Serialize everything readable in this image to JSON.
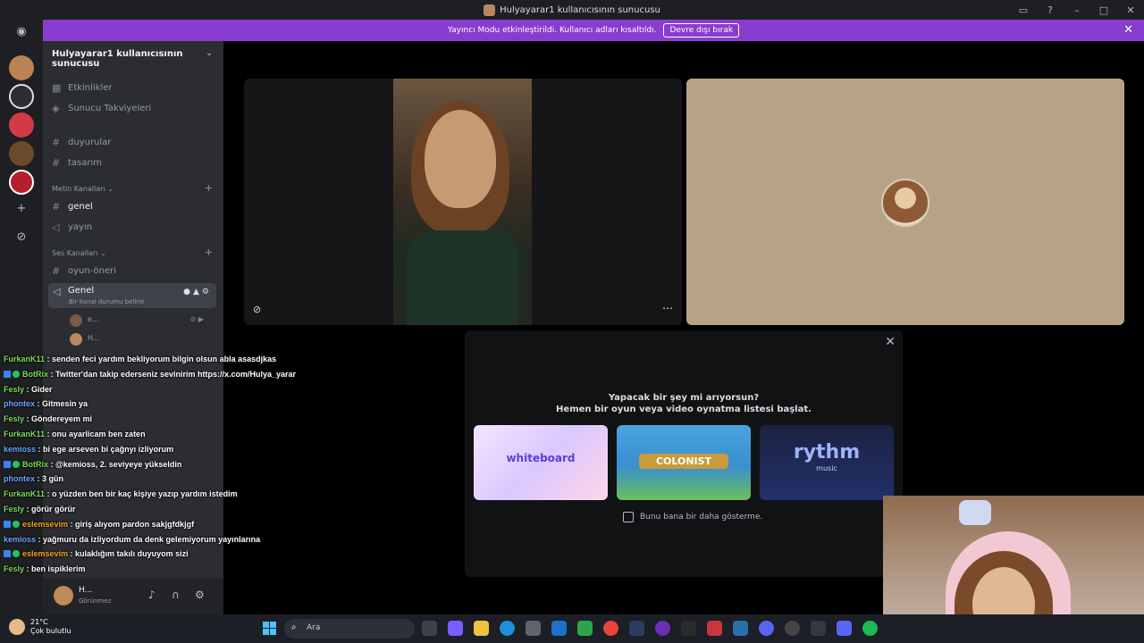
{
  "window": {
    "title": "Hulyayarar1 kullanıcısının sunucusu"
  },
  "banner": {
    "text": "Yayıncı Modu etkinleştirildi. Kullanıcı adları kısaltıldı.",
    "button": "Devre dışı bırak"
  },
  "server": {
    "name": "Hulyayarar1 kullanıcısının sunucusu"
  },
  "channels": {
    "events": "Etkinlikler",
    "boosts": "Sunucu Takviyeleri",
    "top": [
      "duyurular",
      "tasarım"
    ],
    "text_category": "Metin Kanalları",
    "text": [
      "genel",
      "yayın"
    ],
    "voice_category": "Ses Kanalları",
    "voice_other": "oyun-öneri",
    "voice_active": {
      "name": "Genel",
      "status": "Bir kanal durumu belirle"
    },
    "voice_users": [
      "e...",
      "H..."
    ]
  },
  "user_panel": {
    "name": "H...",
    "status": "Görünmez"
  },
  "chat": [
    {
      "user": "FurkanK11",
      "color": "#7cdb5a",
      "text": "senden feci yardım bekliyorum bilgin olsun abla asasdjkas"
    },
    {
      "user": "BotRix",
      "color": "#7cdb5a",
      "badge": true,
      "text": "Twitter'dan takip ederseniz sevinirim https://x.com/Hulya_yarar"
    },
    {
      "user": "Fesly",
      "color": "#7cdb5a",
      "text": "Gider"
    },
    {
      "user": "phontex",
      "color": "#6aa8ff",
      "text": "Gitmesin ya"
    },
    {
      "user": "Fesly",
      "color": "#7cdb5a",
      "text": "Göndereyem mi"
    },
    {
      "user": "FurkanK11",
      "color": "#7cdb5a",
      "text": "onu ayarlicam ben zaten"
    },
    {
      "user": "kemioss",
      "color": "#6aa8ff",
      "text": "bi ege arseven bi çağnyı izliyorum"
    },
    {
      "user": "BotRix",
      "color": "#7cdb5a",
      "badge": true,
      "text": "@kemioss, 2. seviyeye yükseldin"
    },
    {
      "user": "phontex",
      "color": "#6aa8ff",
      "text": "3 gün"
    },
    {
      "user": "FurkanK11",
      "color": "#7cdb5a",
      "text": "o yüzden ben bir kaç kişiye yazıp yardım istedim"
    },
    {
      "user": "Fesly",
      "color": "#7cdb5a",
      "text": "görür görür"
    },
    {
      "user": "eslemsevim",
      "color": "#f5a524",
      "badge": true,
      "text": "giriş alıyom pardon sakjgfdkjgf"
    },
    {
      "user": "kemioss",
      "color": "#6aa8ff",
      "text": "yağmuru da izliyordum da denk gelemiyorum yayınlarına"
    },
    {
      "user": "eslemsevim",
      "color": "#f5a524",
      "badge": true,
      "text": "kulaklığım takılı duyuyom sizi"
    },
    {
      "user": "Fesly",
      "color": "#7cdb5a",
      "text": "ben ispiklerim"
    }
  ],
  "activity": {
    "title": "Yapacak bir şey mi arıyorsun?",
    "subtitle": "Hemen bir oyun veya video oynatma listesi başlat.",
    "cards": [
      "whiteboard",
      "COLONIST",
      "rythm"
    ],
    "card3_sub": "music",
    "checkbox": "Bunu bana bir daha gösterme."
  },
  "taskbar": {
    "temp": "21°C",
    "weather": "Çok bulutlu",
    "search": "Ara"
  }
}
